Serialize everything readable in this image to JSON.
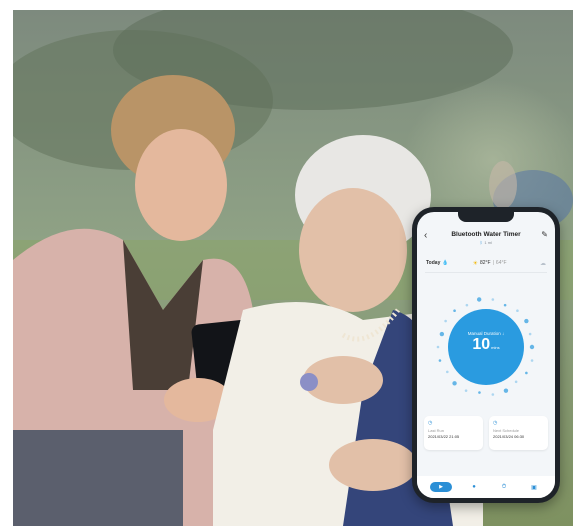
{
  "app": {
    "title": "Bluetooth Water Timer",
    "subtitle": "1 ml",
    "back_icon": "chevron-left-icon",
    "edit_icon": "edit-icon",
    "bluetooth_icon": "bluetooth-icon"
  },
  "weather": {
    "day": "Today",
    "temp_high": "82°F",
    "separator": "|",
    "temp_low": "64°F",
    "icons": [
      "water-drop-icon",
      "sun-icon",
      "cloud-icon"
    ]
  },
  "gauge": {
    "label": "Manual Duration ↓",
    "value": "10",
    "unit": "mins"
  },
  "cards": [
    {
      "icon": "clock-icon",
      "label": "Last Run",
      "value": "2021/03/22 21:05"
    },
    {
      "icon": "calendar-icon",
      "label": "Next Schedule",
      "value": "2021/03/24 06:30"
    }
  ],
  "tabbar": {
    "items": [
      {
        "icon": "play-icon",
        "glyph": "▶",
        "active": true
      },
      {
        "icon": "record-icon",
        "glyph": "●",
        "active": false
      },
      {
        "icon": "timer-icon",
        "glyph": "⏱",
        "active": false
      },
      {
        "icon": "settings-icon",
        "glyph": "▣",
        "active": false
      }
    ]
  },
  "colors": {
    "accent": "#2a9be0",
    "screen_bg": "#f3f6f9",
    "phone_frame": "#1e2329"
  }
}
